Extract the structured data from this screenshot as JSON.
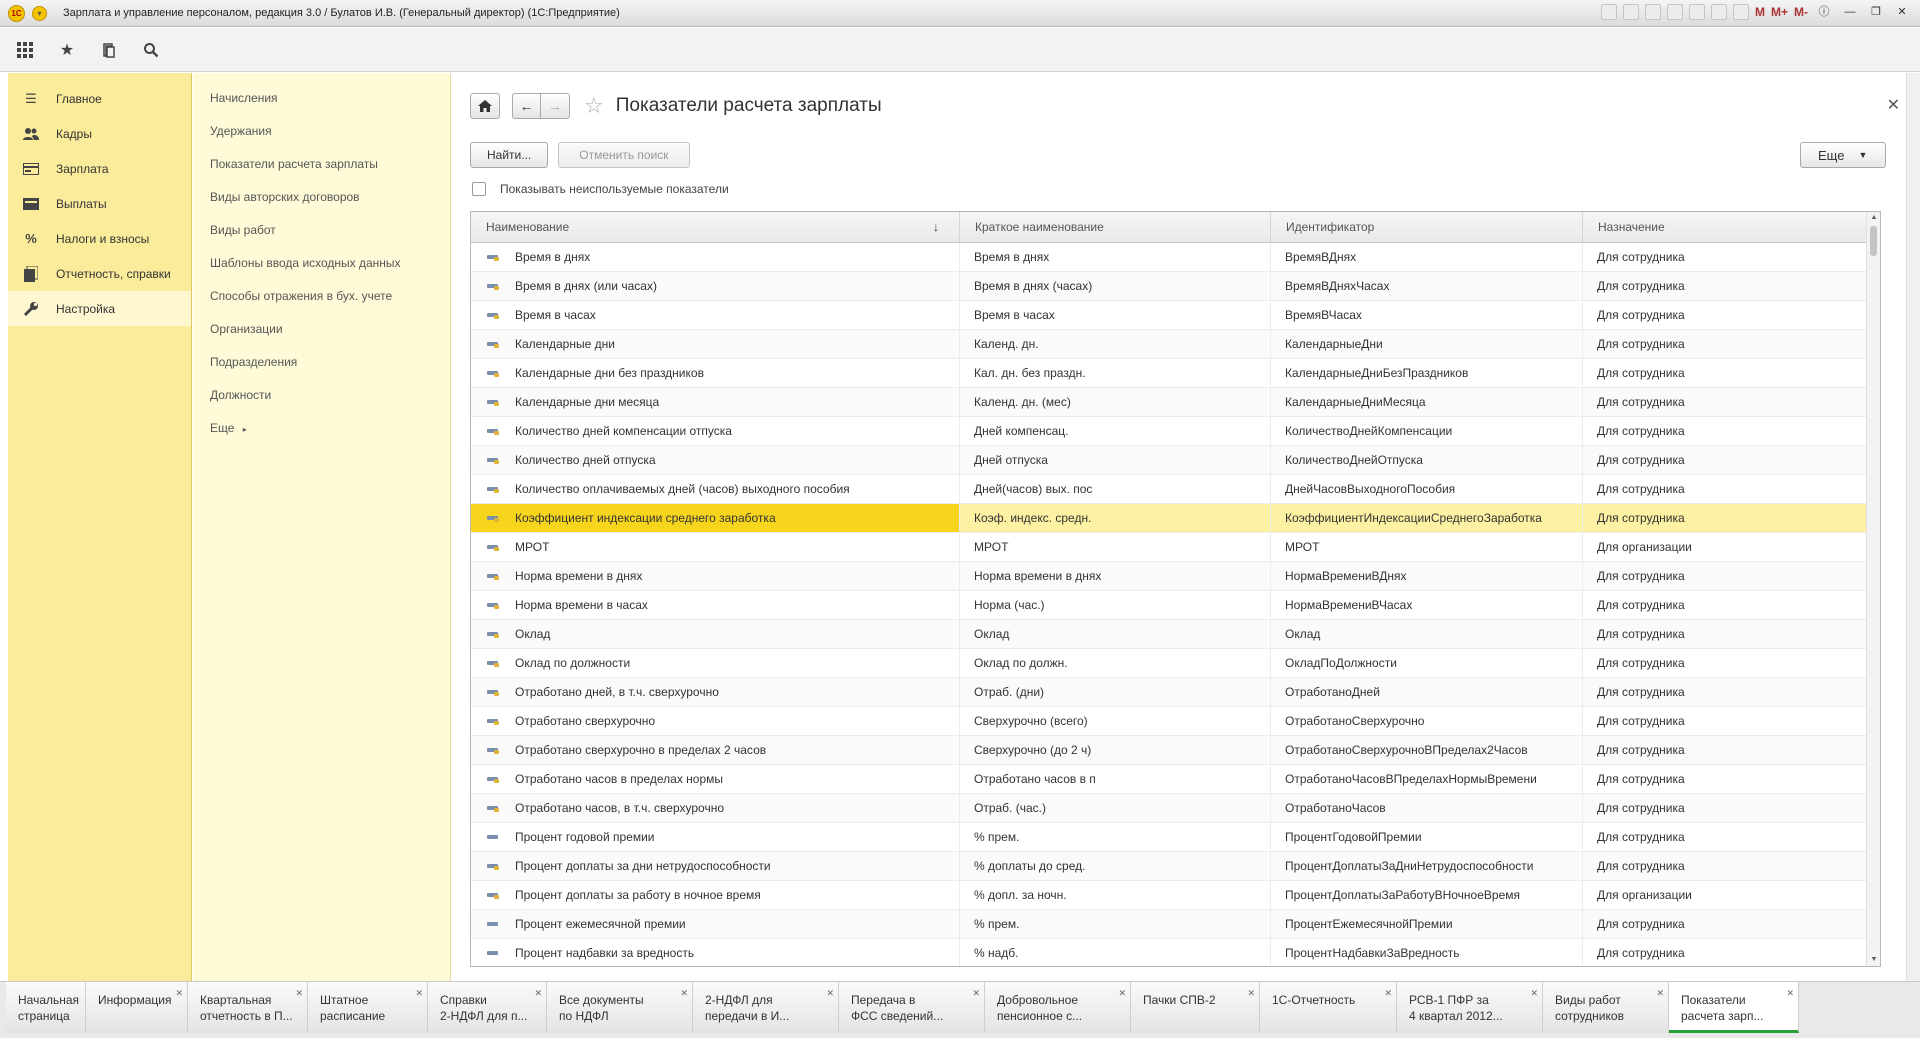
{
  "window": {
    "title": "Зарплата и управление персоналом, редакция 3.0 / Булатов И.В. (Генеральный директор)  (1С:Предприятие)",
    "logo": "1С",
    "mem_buttons": [
      "M",
      "M+",
      "M-"
    ]
  },
  "toolbar": {
    "icons": [
      "apps-grid-icon",
      "star-icon",
      "history-icon",
      "search-icon"
    ]
  },
  "sections": [
    {
      "label": "Главное",
      "icon": "menu-lines-icon"
    },
    {
      "label": "Кадры",
      "icon": "people-icon"
    },
    {
      "label": "Зарплата",
      "icon": "wallet-icon"
    },
    {
      "label": "Выплаты",
      "icon": "payments-icon"
    },
    {
      "label": "Налоги и взносы",
      "icon": "percent-icon"
    },
    {
      "label": "Отчетность, справки",
      "icon": "reports-icon"
    },
    {
      "label": "Настройка",
      "icon": "wrench-icon"
    }
  ],
  "functions": [
    "Начисления",
    "Удержания",
    "Показатели расчета зарплаты",
    "Виды авторских договоров",
    "Виды работ",
    "Шаблоны ввода исходных данных",
    "Способы отражения в бух. учете",
    "Организации",
    "Подразделения",
    "Должности",
    "Еще"
  ],
  "form": {
    "title": "Показатели расчета зарплаты",
    "find_button": "Найти...",
    "cancel_search_button": "Отменить поиск",
    "more_button": "Еще",
    "show_unused_label": "Показывать неиспользуемые показатели",
    "show_unused_checked": false
  },
  "table": {
    "columns": [
      "Наименование",
      "Краткое наименование",
      "Идентификатор",
      "Назначение"
    ],
    "sort_indicator": "↓",
    "selected_index": 9,
    "rows": [
      {
        "name": "Время в днях",
        "short": "Время в днях",
        "id": "ВремяВДнях",
        "purpose": "Для сотрудника",
        "icon": "calc"
      },
      {
        "name": "Время в днях (или часах)",
        "short": "Время в днях (часах)",
        "id": "ВремяВДняхЧасах",
        "purpose": "Для сотрудника",
        "icon": "calc"
      },
      {
        "name": "Время в часах",
        "short": "Время в часах",
        "id": "ВремяВЧасах",
        "purpose": "Для сотрудника",
        "icon": "calc"
      },
      {
        "name": "Календарные дни",
        "short": "Календ. дн.",
        "id": "КалендарныеДни",
        "purpose": "Для сотрудника",
        "icon": "calc"
      },
      {
        "name": "Календарные дни без праздников",
        "short": "Кал. дн. без праздн.",
        "id": "КалендарныеДниБезПраздников",
        "purpose": "Для сотрудника",
        "icon": "calc"
      },
      {
        "name": "Календарные дни месяца",
        "short": "Календ. дн. (мес)",
        "id": "КалендарныеДниМесяца",
        "purpose": "Для сотрудника",
        "icon": "calc"
      },
      {
        "name": "Количество дней компенсации отпуска",
        "short": "Дней компенсац.",
        "id": "КоличествоДнейКомпенсации",
        "purpose": "Для сотрудника",
        "icon": "calc"
      },
      {
        "name": "Количество дней отпуска",
        "short": "Дней отпуска",
        "id": "КоличествоДнейОтпуска",
        "purpose": "Для сотрудника",
        "icon": "calc"
      },
      {
        "name": "Количество оплачиваемых дней (часов) выходного пособия",
        "short": "Дней(часов) вых. пос",
        "id": "ДнейЧасовВыходногоПособия",
        "purpose": "Для сотрудника",
        "icon": "calc"
      },
      {
        "name": "Коэффициент индексации среднего заработка",
        "short": "Коэф. индекс. средн.",
        "id": "КоэффициентИндексацииСреднегоЗаработка",
        "purpose": "Для сотрудника",
        "icon": "calc"
      },
      {
        "name": "МРОТ",
        "short": "МРОТ",
        "id": "МРОТ",
        "purpose": "Для организации",
        "icon": "calc"
      },
      {
        "name": "Норма времени в днях",
        "short": "Норма времени в днях",
        "id": "НормаВремениВДнях",
        "purpose": "Для сотрудника",
        "icon": "calc"
      },
      {
        "name": "Норма времени в часах",
        "short": "Норма (час.)",
        "id": "НормаВремениВЧасах",
        "purpose": "Для сотрудника",
        "icon": "calc"
      },
      {
        "name": "Оклад",
        "short": "Оклад",
        "id": "Оклад",
        "purpose": "Для сотрудника",
        "icon": "calc"
      },
      {
        "name": "Оклад по должности",
        "short": "Оклад по должн.",
        "id": "ОкладПоДолжности",
        "purpose": "Для сотрудника",
        "icon": "calc"
      },
      {
        "name": "Отработано дней, в т.ч. сверхурочно",
        "short": "Отраб. (дни)",
        "id": "ОтработаноДней",
        "purpose": "Для сотрудника",
        "icon": "calc"
      },
      {
        "name": "Отработано сверхурочно",
        "short": "Сверхурочно (всего)",
        "id": "ОтработаноСверхурочно",
        "purpose": "Для сотрудника",
        "icon": "calc"
      },
      {
        "name": "Отработано сверхурочно в пределах 2 часов",
        "short": "Сверхурочно (до 2 ч)",
        "id": "ОтработаноСверхурочноВПределах2Часов",
        "purpose": "Для сотрудника",
        "icon": "calc"
      },
      {
        "name": "Отработано часов в пределах нормы",
        "short": "Отработано часов в п",
        "id": "ОтработаноЧасовВПределахНормыВремени",
        "purpose": "Для сотрудника",
        "icon": "calc"
      },
      {
        "name": "Отработано часов, в т.ч. сверхурочно",
        "short": "Отраб. (час.)",
        "id": "ОтработаноЧасов",
        "purpose": "Для сотрудника",
        "icon": "calc"
      },
      {
        "name": "Процент годовой премии",
        "short": "% прем.",
        "id": "ПроцентГодовойПремии",
        "purpose": "Для сотрудника",
        "icon": "plain"
      },
      {
        "name": "Процент доплаты за дни нетрудоспособности",
        "short": "% доплаты до сред.",
        "id": "ПроцентДоплатыЗаДниНетрудоспособности",
        "purpose": "Для сотрудника",
        "icon": "calc"
      },
      {
        "name": "Процент доплаты за работу в ночное время",
        "short": "% допл. за ночн.",
        "id": "ПроцентДоплатыЗаРаботуВНочноеВремя",
        "purpose": "Для организации",
        "icon": "calc"
      },
      {
        "name": "Процент ежемесячной премии",
        "short": "% прем.",
        "id": "ПроцентЕжемесячнойПремии",
        "purpose": "Для сотрудника",
        "icon": "plain"
      },
      {
        "name": "Процент надбавки за вредность",
        "short": "% надб.",
        "id": "ПроцентНадбавкиЗаВредность",
        "purpose": "Для сотрудника",
        "icon": "plain"
      }
    ]
  },
  "tabs": [
    {
      "label": "Начальная\nстраница",
      "closable": false,
      "width": 80
    },
    {
      "label": "Информация",
      "closable": true,
      "width": 102
    },
    {
      "label": "Квартальная\nотчетность в П...",
      "closable": true,
      "width": 120
    },
    {
      "label": "Штатное\nрасписание",
      "closable": true,
      "width": 120
    },
    {
      "label": "Справки\n2-НДФЛ для п...",
      "closable": true,
      "width": 119
    },
    {
      "label": "Все документы\nпо НДФЛ",
      "closable": true,
      "width": 146
    },
    {
      "label": "2-НДФЛ для\nпередачи в И...",
      "closable": true,
      "width": 146
    },
    {
      "label": "Передача в\nФСС сведений...",
      "closable": true,
      "width": 146
    },
    {
      "label": "Добровольное\nпенсионное с...",
      "closable": true,
      "width": 146
    },
    {
      "label": "Пачки СПВ-2",
      "closable": true,
      "width": 129
    },
    {
      "label": "1С-Отчетность",
      "closable": true,
      "width": 137
    },
    {
      "label": "РСВ-1 ПФР за\n4 квартал 2012...",
      "closable": true,
      "width": 146
    },
    {
      "label": "Виды работ\nсотрудников",
      "closable": true,
      "width": 126
    },
    {
      "label": "Показатели\nрасчета зарп...",
      "closable": true,
      "width": 130,
      "active": true
    }
  ]
}
